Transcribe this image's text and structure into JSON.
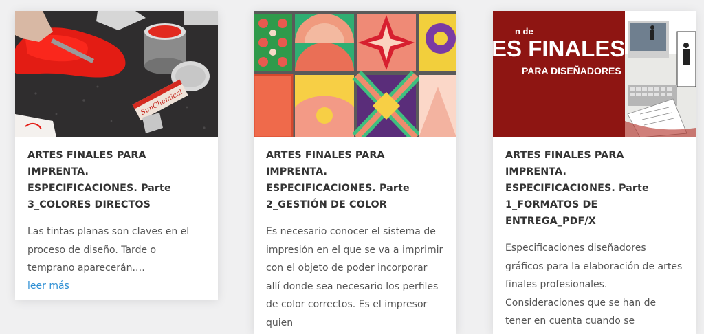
{
  "posts": [
    {
      "title_line1": "ARTES FINALES PARA IMPRENTA.",
      "title_line2": "ESPECIFICACIONES. Parte",
      "title_line3": "3_COLORES DIRECTOS",
      "title_line4": "",
      "excerpt": "Las tintas planas son claves en el proceso de diseño. Tarde o temprano aparecerán.…",
      "read_more": "leer más",
      "thumb_text": "SunChemical"
    },
    {
      "title_line1": "ARTES FINALES PARA IMPRENTA.",
      "title_line2": "ESPECIFICACIONES. Parte",
      "title_line3": "2_GESTIÓN DE COLOR",
      "title_line4": "",
      "excerpt": "Es necesario conocer el sistema de impresión en el que se va a imprimir con el objeto de poder incorporar allí donde sea necesario los perfiles de color correctos. Es el impresor quien"
    },
    {
      "title_line1": "ARTES FINALES PARA IMPRENTA.",
      "title_line2": "ESPECIFICACIONES. Parte",
      "title_line3": "1_FORMATOS DE",
      "title_line4": "ENTREGA_PDF/X",
      "excerpt": "Especificaciones diseñadores gráficos para la elaboración de artes finales profesionales. Consideraciones que se han de tener en cuenta cuando se",
      "thumb_text_top": "n de",
      "thumb_text_main": "ES FINALES",
      "thumb_text_sub": "PARA DISEÑADORES"
    }
  ],
  "colors": {
    "link": "#2e8fd4",
    "title": "#333333",
    "excerpt": "#555555",
    "banner_red": "#8e1512"
  }
}
